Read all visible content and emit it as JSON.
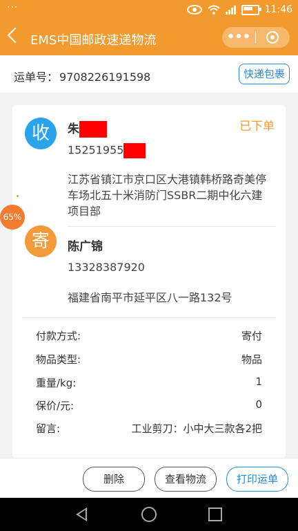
{
  "status_bar": {
    "dots": "···",
    "network": "4G",
    "time": "11:46"
  },
  "header": {
    "title": "EMS中国邮政速递物流",
    "more_glyph": "•••"
  },
  "waybill": {
    "label": "运单号：",
    "number": "9708226191598",
    "quick_button": "快递包裹"
  },
  "recipient": {
    "avatar": "收",
    "name": "朱",
    "phone": "15251955",
    "address": "江苏省镇江市京口区大港镇韩桥路奇美停车场北五十米消防门SSBR二期中化六建项目部",
    "status": "已下单"
  },
  "sender": {
    "avatar": "寄",
    "name": "陈广锦",
    "phone": "13328387920",
    "address": "福建省南平市延平区八一路132号"
  },
  "details": [
    {
      "label": "付款方式:",
      "value": "寄付"
    },
    {
      "label": "物品类型:",
      "value": "物品"
    },
    {
      "label": "重量/kg:",
      "value": "1"
    },
    {
      "label": "保价/元:",
      "value": "0"
    },
    {
      "label": "留言:",
      "value": "工业剪刀：小中大三款各2把"
    }
  ],
  "float_badge": "65%",
  "actions": {
    "delete": "删除",
    "track": "查看物流",
    "print": "打印运单"
  },
  "colors": {
    "brand": "#f29a2e",
    "accent": "#2a8bd8",
    "redaction": "#ff0000"
  }
}
